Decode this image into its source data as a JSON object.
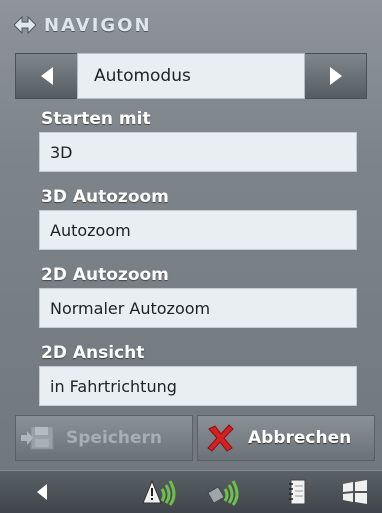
{
  "header": {
    "brand": "NAVIGON"
  },
  "mode_selector": {
    "value": "Automodus"
  },
  "settings": [
    {
      "label": "Starten mit",
      "value": "3D"
    },
    {
      "label": "3D Autozoom",
      "value": "Autozoom"
    },
    {
      "label": "2D Autozoom",
      "value": "Normaler Autozoom"
    },
    {
      "label": "2D Ansicht",
      "value": "in Fahrtrichtung"
    }
  ],
  "actions": {
    "save_label": "Speichern",
    "cancel_label": "Abbrechen"
  },
  "bottombar": {
    "icons": [
      "back-arrow-icon",
      "gps-warning-icon",
      "gps-signal-icon",
      "notepad-icon",
      "windows-icon"
    ]
  },
  "colors": {
    "cancel_x": "#d42020",
    "field_bg": "#e9eef3",
    "label_text": "#ffffff"
  }
}
